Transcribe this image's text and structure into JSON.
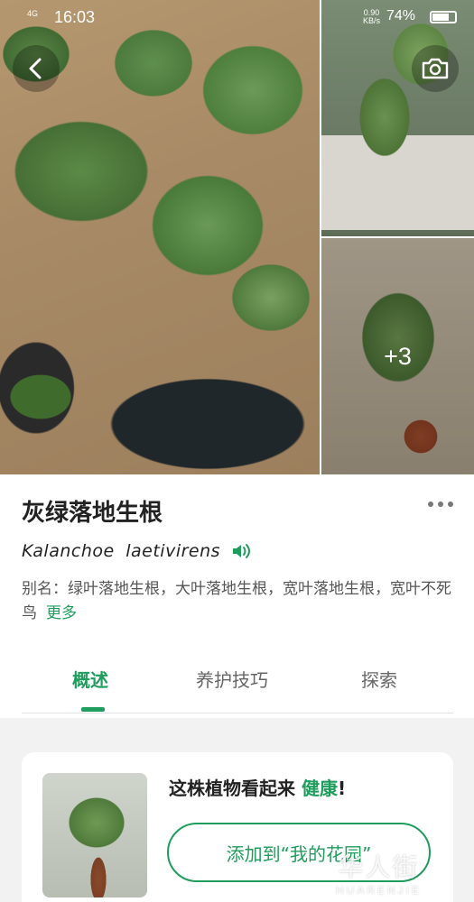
{
  "status_bar": {
    "signal": "4G",
    "time": "16:03",
    "net_speed": "0.90\nKB/s",
    "battery": "74%"
  },
  "gallery": {
    "extra_count": "+3"
  },
  "icons": {
    "back": "chevron-left-icon",
    "camera": "camera-icon",
    "audio": "speaker-icon",
    "more": "more-dots-icon"
  },
  "plant": {
    "name": "灰绿落地生根",
    "latin": "Kalanchoe laetivirens",
    "aliases": "别名：绿叶落地生根，大叶落地生根，宽叶落地生根，宽叶不死鸟",
    "more_label": "更多"
  },
  "tabs": [
    {
      "label": "概述"
    },
    {
      "label": "养护技巧"
    },
    {
      "label": "探索"
    }
  ],
  "health": {
    "text_prefix": "这株植物看起来 ",
    "status": "健康",
    "text_suffix": "!",
    "add_button": "添加到“我的花园”"
  },
  "watermark": {
    "cn": "华人街",
    "en": "HUARENJIE"
  },
  "colors": {
    "accent": "#1f9d5c",
    "background": "#f2f2f2"
  }
}
